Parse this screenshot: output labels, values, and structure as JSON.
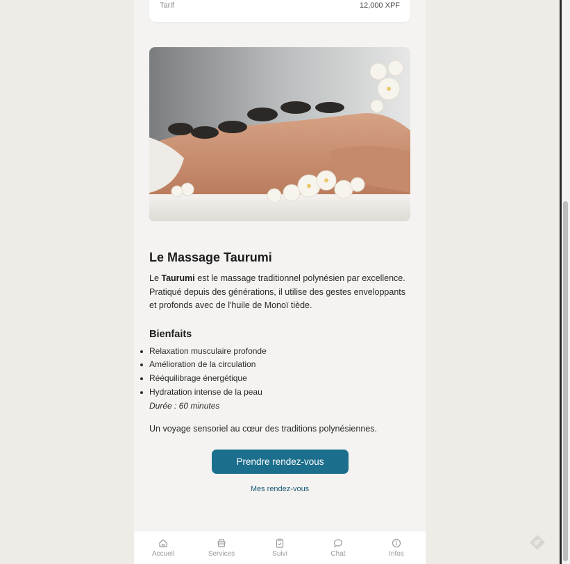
{
  "tarif": {
    "label": "Tarif",
    "value": "12,000 XPF"
  },
  "hero": {
    "icon": "massage-photo"
  },
  "article": {
    "title": "Le Massage Taurumi",
    "intro_prefix": "Le ",
    "intro_bold": "Taurumi",
    "intro_rest": " est le massage traditionnel polynésien par excellence. Pratiqué depuis des générations, il utilise des gestes enveloppants et profonds avec de l'huile de Monoï tiède.",
    "benefits_title": "Bienfaits",
    "benefits": [
      "Relaxation musculaire profonde",
      "Amélioration de la circulation",
      "Rééquilibrage énergétique",
      "Hydratation intense de la peau"
    ],
    "duration": "Durée : 60 minutes",
    "outro": "Un voyage sensoriel au cœur des traditions polynésiennes."
  },
  "actions": {
    "book_label": "Prendre rendez-vous",
    "my_appointments_label": "Mes rendez-vous"
  },
  "tabs": [
    {
      "label": "Accueil",
      "icon": "home-icon"
    },
    {
      "label": "Services",
      "icon": "services-icon"
    },
    {
      "label": "Suivi",
      "icon": "clipboard-icon"
    },
    {
      "label": "Chat",
      "icon": "chat-icon"
    },
    {
      "label": "Infos",
      "icon": "info-icon"
    }
  ],
  "colors": {
    "accent": "#1b6e8c",
    "background": "#efece8"
  }
}
